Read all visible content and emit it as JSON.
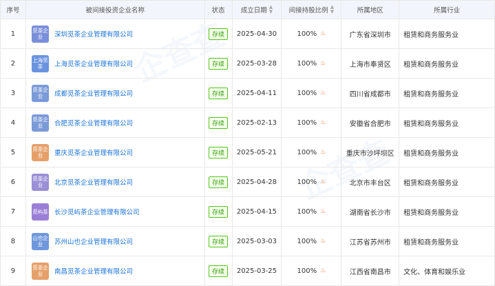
{
  "headers": {
    "index": "序号",
    "company": "被间接投资企业名称",
    "status": "状态",
    "date": "成立日期",
    "ratio": "间接持股比例",
    "region": "所属地区",
    "industry": "所属行业"
  },
  "rows": [
    {
      "index": "1",
      "logo": "觅茶企业",
      "logo_color": "#7a8fd9",
      "name": "深圳觅茶企业管理有限公司",
      "status": "存续",
      "date": "2025-04-30",
      "ratio": "100%",
      "region": "广东省深圳市",
      "industry": "租赁和商务服务业"
    },
    {
      "index": "2",
      "logo": "上海觅茶",
      "logo_color": "#6a93e0",
      "name": "上海觅茶企业管理有限公司",
      "status": "存续",
      "date": "2025-03-28",
      "ratio": "100%",
      "region": "上海市奉贤区",
      "industry": "租赁和商务服务业"
    },
    {
      "index": "3",
      "logo": "觅茶企业",
      "logo_color": "#7b9ad8",
      "name": "成都觅茶企业管理有限公司",
      "status": "存续",
      "date": "2025-04-11",
      "ratio": "100%",
      "region": "四川省成都市",
      "industry": "租赁和商务服务业"
    },
    {
      "index": "4",
      "logo": "觅茶企业",
      "logo_color": "#7b9ad8",
      "name": "合肥觅茶企业管理有限公司",
      "status": "存续",
      "date": "2025-02-13",
      "ratio": "100%",
      "region": "安徽省合肥市",
      "industry": "租赁和商务服务业"
    },
    {
      "index": "5",
      "logo": "觅茶企业",
      "logo_color": "#e5a06a",
      "name": "重庆觅茶企业管理有限公司",
      "status": "存续",
      "date": "2025-05-21",
      "ratio": "100%",
      "region": "重庆市沙坪坝区",
      "industry": "租赁和商务服务业"
    },
    {
      "index": "6",
      "logo": "觅茶企业",
      "logo_color": "#9b8fd6",
      "name": "北京觅茶企业管理有限公司",
      "status": "存续",
      "date": "2025-04-28",
      "ratio": "100%",
      "region": "北京市丰台区",
      "industry": "租赁和商务服务业"
    },
    {
      "index": "7",
      "logo": "觅屿茶",
      "logo_color": "#9b7fd6",
      "name": "长沙觅屿茶企业管理有限公司",
      "status": "存续",
      "date": "2025-04-15",
      "ratio": "100%",
      "region": "湖南省长沙市",
      "industry": "租赁和商务服务业"
    },
    {
      "index": "8",
      "logo": "山也企业",
      "logo_color": "#6f97dc",
      "name": "苏州山也企业管理有限公司",
      "status": "存续",
      "date": "2025-03-03",
      "ratio": "100%",
      "region": "江苏省苏州市",
      "industry": "租赁和商务服务业"
    },
    {
      "index": "9",
      "logo": "觅茶企业",
      "logo_color": "#e5a06a",
      "name": "南昌觅茶企业管理有限公司",
      "status": "存续",
      "date": "2025-03-25",
      "ratio": "100%",
      "region": "江西省南昌市",
      "industry": "文化、体育和娱乐业"
    }
  ],
  "icons": {
    "sort": "sort-arrows-icon",
    "equity_chain": "equity-chain-icon"
  },
  "colors": {
    "link": "#1a73d9",
    "status_green": "#52c41a",
    "header_bg": "#f2f6fc",
    "chain_icon": "#e0703c"
  }
}
